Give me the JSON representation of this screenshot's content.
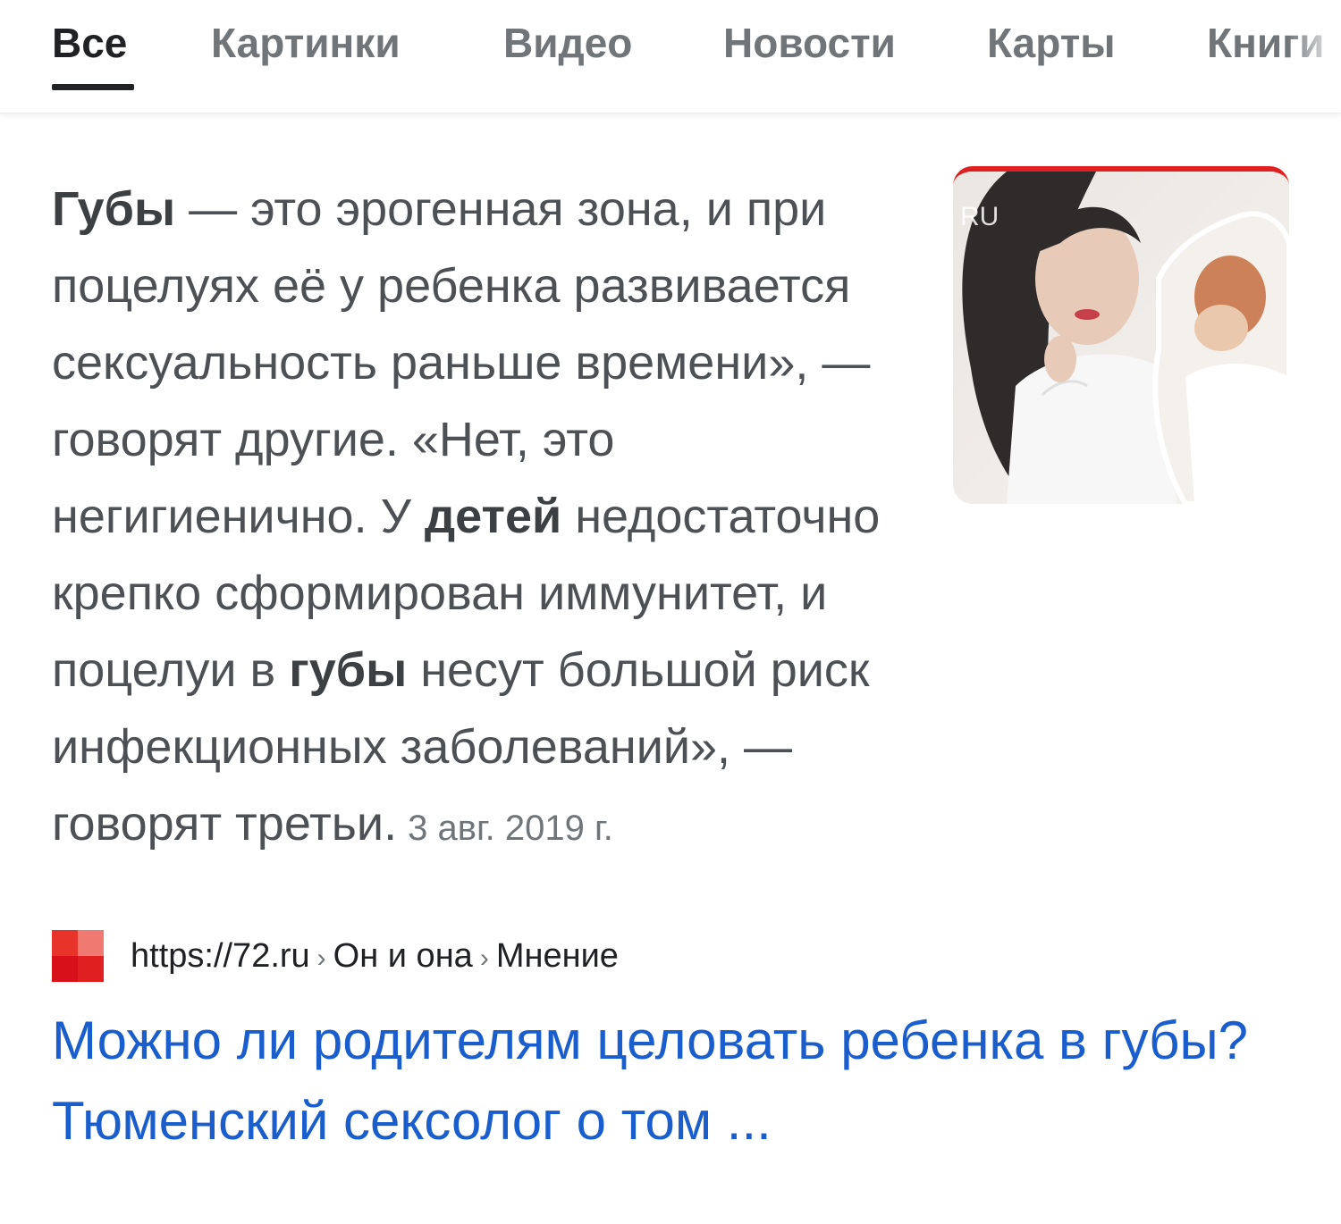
{
  "tabs": {
    "items": [
      {
        "label": "Все"
      },
      {
        "label": "Картинки"
      },
      {
        "label": "Видео"
      },
      {
        "label": "Новости"
      },
      {
        "label": "Карты"
      },
      {
        "label": "Книги"
      }
    ]
  },
  "snippet": {
    "bold_1": "Губы",
    "text_1": " — это эрогенная зона, и при поцелуях её у ребенка развивается сексуальность раньше времени», — говорят другие. «Нет, это негигиенично. У ",
    "bold_2": "детей",
    "text_2": " недостаточно крепко сформирован иммунитет, и поцелуи в ",
    "bold_3": "губы",
    "text_3": " несут большой риск инфекционных заболеваний», — говорят третьи.",
    "date": "3 авг. 2019 г."
  },
  "thumbnail": {
    "watermark": "RU"
  },
  "source": {
    "url": "https://72.ru",
    "crumb_1": "Он и она",
    "crumb_2": "Мнение",
    "separator": "›"
  },
  "result": {
    "title": "Можно ли родителям целовать ребенка в губы? Тюменский сексолог о том ..."
  },
  "colors": {
    "link": "#1a5dcc",
    "text": "#4d5156",
    "brand_red": "#e02020"
  }
}
